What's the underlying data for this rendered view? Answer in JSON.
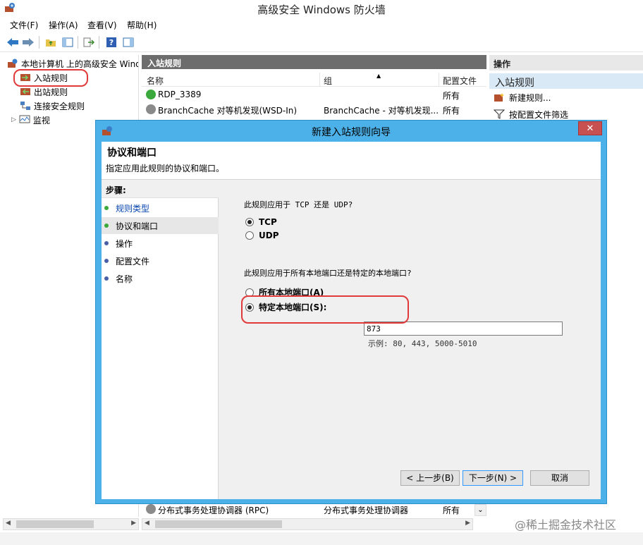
{
  "window": {
    "title": "高级安全 Windows 防火墙"
  },
  "menu": [
    "文件(F)",
    "操作(A)",
    "查看(V)",
    "帮助(H)"
  ],
  "tree": {
    "root": "本地计算机 上的高级安全 Wind",
    "items": [
      "入站规则",
      "出站规则",
      "连接安全规则",
      "监视"
    ]
  },
  "center": {
    "header": "入站规则",
    "columns": [
      "名称",
      "组",
      "配置文件"
    ],
    "rows": [
      {
        "name": "RDP_3389",
        "group": "",
        "profile": "所有"
      },
      {
        "name": "BranchCache 对等机发现(WSD-In)",
        "group": "BranchCache - 对等机发现...",
        "profile": "所有"
      }
    ],
    "bottom_row": {
      "name": "分布式事务处理协调器 (RPC)",
      "group": "分布式事务处理协调器",
      "profile": "所有"
    }
  },
  "actions": {
    "header": "操作",
    "section": "入站规则",
    "items": [
      "新建规则...",
      "按配置文件筛选"
    ]
  },
  "dialog": {
    "title": "新建入站规则向导",
    "heading": "协议和端口",
    "subheading": "指定应用此规则的协议和端口。",
    "steps_title": "步骤:",
    "steps": [
      "规则类型",
      "协议和端口",
      "操作",
      "配置文件",
      "名称"
    ],
    "q1": "此规则应用于 TCP 还是 UDP?",
    "tcp_label": "TCP",
    "udp_label": "UDP",
    "q2": "此规则应用于所有本地端口还是特定的本地端口?",
    "all_ports_label": "所有本地端口(A)",
    "specific_ports_label": "特定本地端口(S):",
    "port_value": "873",
    "port_example": "示例: 80, 443, 5000-5010",
    "back_button": "< 上一步(B)",
    "next_button": "下一步(N) >",
    "cancel_button": "取消"
  },
  "watermark": "@稀土掘金技术社区",
  "colors": {
    "dialog_frame": "#4cb1e8",
    "panel_header": "#6d6d6d",
    "highlight": "#e03a3a",
    "close_button": "#c75050",
    "step_dot": "#3aa83a"
  }
}
